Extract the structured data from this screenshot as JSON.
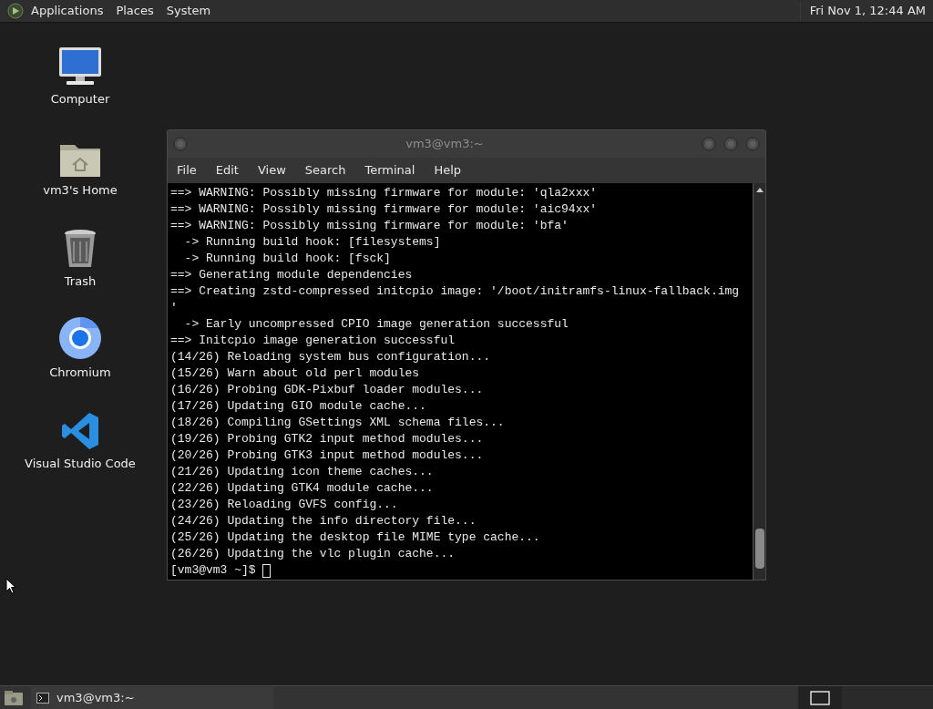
{
  "top_panel": {
    "menus": [
      "Applications",
      "Places",
      "System"
    ],
    "clock": "Fri Nov 1, 12:44 AM"
  },
  "desktop_icons": [
    {
      "kind": "computer",
      "label": "Computer"
    },
    {
      "kind": "home",
      "label": "vm3's Home"
    },
    {
      "kind": "trash",
      "label": "Trash"
    },
    {
      "kind": "chromium",
      "label": "Chromium"
    },
    {
      "kind": "vscode",
      "label": "Visual Studio Code"
    }
  ],
  "terminal": {
    "title": "vm3@vm3:~",
    "menu": [
      "File",
      "Edit",
      "View",
      "Search",
      "Terminal",
      "Help"
    ],
    "lines": [
      "==> WARNING: Possibly missing firmware for module: 'qla2xxx'",
      "==> WARNING: Possibly missing firmware for module: 'aic94xx'",
      "==> WARNING: Possibly missing firmware for module: 'bfa'",
      "  -> Running build hook: [filesystems]",
      "  -> Running build hook: [fsck]",
      "==> Generating module dependencies",
      "==> Creating zstd-compressed initcpio image: '/boot/initramfs-linux-fallback.img",
      "'",
      "  -> Early uncompressed CPIO image generation successful",
      "==> Initcpio image generation successful",
      "(14/26) Reloading system bus configuration...",
      "(15/26) Warn about old perl modules",
      "(16/26) Probing GDK-Pixbuf loader modules...",
      "(17/26) Updating GIO module cache...",
      "(18/26) Compiling GSettings XML schema files...",
      "(19/26) Probing GTK2 input method modules...",
      "(20/26) Probing GTK3 input method modules...",
      "(21/26) Updating icon theme caches...",
      "(22/26) Updating GTK4 module cache...",
      "(23/26) Reloading GVFS config...",
      "(24/26) Updating the info directory file...",
      "(25/26) Updating the desktop file MIME type cache...",
      "(26/26) Updating the vlc plugin cache..."
    ],
    "prompt": "[vm3@vm3 ~]$ "
  },
  "taskbar": {
    "tasks": [
      {
        "label": "vm3@vm3:~",
        "selected": false
      }
    ]
  }
}
